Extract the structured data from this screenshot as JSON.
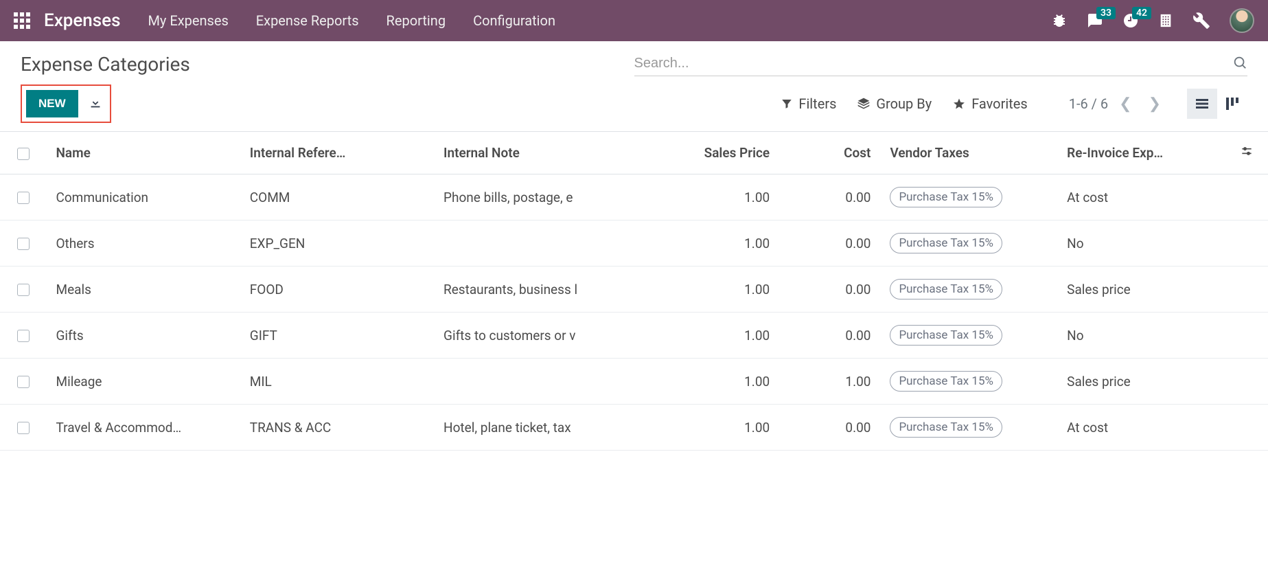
{
  "navbar": {
    "brand": "Expenses",
    "menu": [
      "My Expenses",
      "Expense Reports",
      "Reporting",
      "Configuration"
    ],
    "badges": {
      "messages": "33",
      "activities": "42"
    }
  },
  "breadcrumb": "Expense Categories",
  "buttons": {
    "new": "NEW"
  },
  "search": {
    "placeholder": "Search..."
  },
  "filters": {
    "filters": "Filters",
    "groupby": "Group By",
    "favorites": "Favorites"
  },
  "pager": {
    "range": "1-6 / 6"
  },
  "columns": {
    "name": "Name",
    "ref": "Internal Refere…",
    "note": "Internal Note",
    "sales": "Sales Price",
    "cost": "Cost",
    "vendor": "Vendor Taxes",
    "reinv": "Re-Invoice Exp…"
  },
  "rows": [
    {
      "name": "Communication",
      "ref": "COMM",
      "note": "Phone bills, postage, e",
      "sales": "1.00",
      "cost": "0.00",
      "tax": "Purchase Tax 15%",
      "reinv": "At cost"
    },
    {
      "name": "Others",
      "ref": "EXP_GEN",
      "note": "",
      "sales": "1.00",
      "cost": "0.00",
      "tax": "Purchase Tax 15%",
      "reinv": "No"
    },
    {
      "name": "Meals",
      "ref": "FOOD",
      "note": "Restaurants, business l",
      "sales": "1.00",
      "cost": "0.00",
      "tax": "Purchase Tax 15%",
      "reinv": "Sales price"
    },
    {
      "name": "Gifts",
      "ref": "GIFT",
      "note": "Gifts to customers or v",
      "sales": "1.00",
      "cost": "0.00",
      "tax": "Purchase Tax 15%",
      "reinv": "No"
    },
    {
      "name": "Mileage",
      "ref": "MIL",
      "note": "",
      "sales": "1.00",
      "cost": "1.00",
      "tax": "Purchase Tax 15%",
      "reinv": "Sales price"
    },
    {
      "name": "Travel & Accommod…",
      "ref": "TRANS & ACC",
      "note": "Hotel, plane ticket, tax",
      "sales": "1.00",
      "cost": "0.00",
      "tax": "Purchase Tax 15%",
      "reinv": "At cost"
    }
  ]
}
